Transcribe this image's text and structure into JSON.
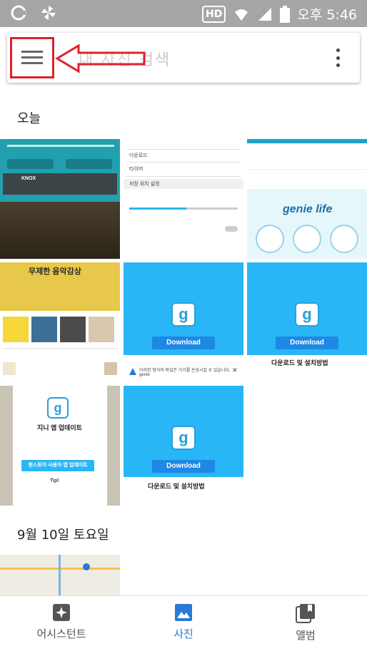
{
  "status_bar": {
    "hd_label": "HD",
    "clock": "오후 5:46"
  },
  "search": {
    "placeholder": "내 사진 검색"
  },
  "sections": [
    {
      "title": "오늘"
    },
    {
      "title": "9월 10일 토요일"
    }
  ],
  "thumbs": {
    "knox_label": "KNOX",
    "menu_rows": [
      "다운로드",
      "타이머",
      "저장 위치 설정"
    ],
    "genie_life": "genie life",
    "promo_title": "무제한 음악감상",
    "download_label": "Download",
    "download_caption": "다운로드 및 설치방법",
    "update_title": "지니 앱 업데이트",
    "update_button": "원스토어 사용자 앱 업데이트",
    "update_tip": "Tip!",
    "warning_text": "이러한 형식의 파일은 기기를 손상시킬 수 있습니다. genie"
  },
  "bottom_nav": {
    "assistant": "어시스턴트",
    "photos": "사진",
    "albums": "앨범"
  },
  "colors": {
    "status_bar": "#a6a6a6",
    "accent": "#2979d6",
    "highlight_red": "#e0202a",
    "genie_cyan": "#29b6f6"
  }
}
